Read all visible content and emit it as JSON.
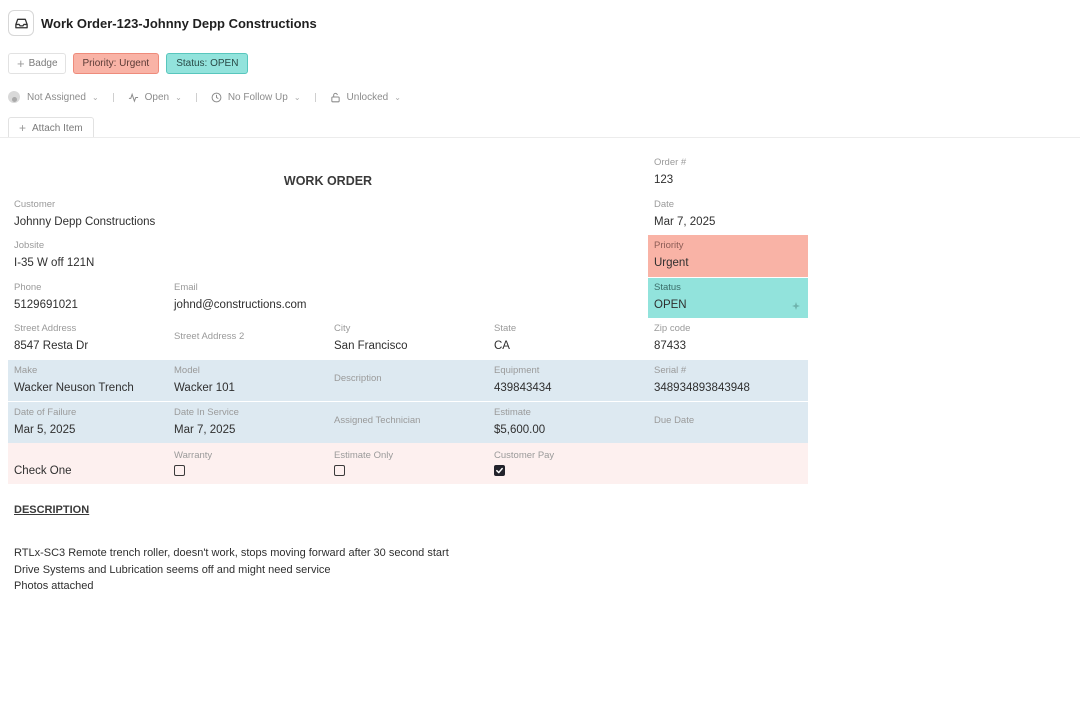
{
  "header": {
    "title": "Work Order-123-Johnny Depp Constructions",
    "icon": "inbox-icon"
  },
  "badges": {
    "add_label": "Badge",
    "priority_label": "Priority: Urgent",
    "status_label": "Status: OPEN",
    "priority_color": "#f9b3a6",
    "status_color": "#92e3dc"
  },
  "toolbar": {
    "assignee": "Not Assigned",
    "state": "Open",
    "follow_up": "No Follow Up",
    "lock": "Unlocked"
  },
  "attach": {
    "label": "Attach Item"
  },
  "form": {
    "heading": "WORK ORDER",
    "order_label": "Order #",
    "order_value": "123",
    "customer_label": "Customer",
    "customer_value": "Johnny Depp Constructions",
    "date_label": "Date",
    "date_value": "Mar 7, 2025",
    "jobsite_label": "Jobsite",
    "jobsite_value": "I-35 W off 121N",
    "priority_label": "Priority",
    "priority_value": "Urgent",
    "phone_label": "Phone",
    "phone_value": "5129691021",
    "email_label": "Email",
    "email_value": "johnd@constructions.com",
    "status_label": "Status",
    "status_value": "OPEN",
    "street_label": "Street Address",
    "street_value": "8547 Resta Dr",
    "street2_label": "Street Address 2",
    "street2_value": "",
    "city_label": "City",
    "city_value": "San Francisco",
    "state_label": "State",
    "state_value": "CA",
    "zip_label": "Zip code",
    "zip_value": "87433",
    "make_label": "Make",
    "make_value": "Wacker Neuson Trench",
    "model_label": "Model",
    "model_value": "Wacker 101",
    "description_label": "Description",
    "description_value": "",
    "equipment_label": "Equipment",
    "equipment_value": "439843434",
    "serial_label": "Serial #",
    "serial_value": "348934893843948",
    "failure_label": "Date of Failure",
    "failure_value": "Mar 5, 2025",
    "in_service_label": "Date In Service",
    "in_service_value": "Mar 7, 2025",
    "technician_label": "Assigned Technician",
    "technician_value": "",
    "estimate_label": "Estimate",
    "estimate_value": "$5,600.00",
    "due_label": "Due Date",
    "due_value": "",
    "check_one_label": "Check One",
    "warranty_label": "Warranty",
    "warranty_checked": false,
    "estimate_only_label": "Estimate Only",
    "estimate_only_checked": false,
    "customer_pay_label": "Customer Pay",
    "customer_pay_checked": true,
    "row_blue_color": "#dde9f1",
    "row_pink_color": "#fdf0ef"
  },
  "description": {
    "heading": "DESCRIPTION",
    "lines": [
      "RTLx-SC3 Remote trench roller, doesn't work, stops moving forward after 30 second start",
      "Drive Systems and Lubrication seems off and might need service",
      "Photos attached"
    ]
  }
}
